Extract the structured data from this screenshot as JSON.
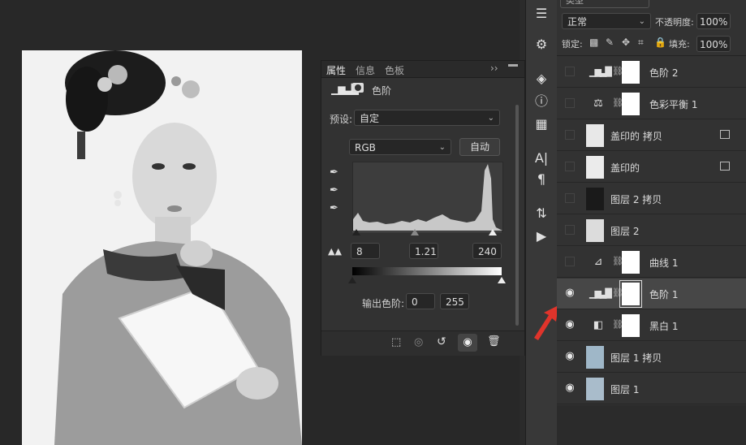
{
  "properties": {
    "tabs": [
      "属性",
      "信息",
      "色板"
    ],
    "panel_title": "色阶",
    "preset_label": "预设:",
    "preset_value": "自定",
    "channel_value": "RGB",
    "auto_label": "自动",
    "input_black": "8",
    "input_mid": "1.21",
    "input_white": "240",
    "output_label": "输出色阶:",
    "output_black": "0",
    "output_white": "255",
    "tab_overflow": "››"
  },
  "layers_panel": {
    "kind_label": "类型",
    "blend_mode": "正常",
    "opacity_label": "不透明度:",
    "opacity_value": "100%",
    "lock_label": "锁定:",
    "fill_label": "填充:",
    "fill_value": "100%",
    "layers": [
      {
        "name": "色阶 2",
        "visible": false,
        "type": "levels"
      },
      {
        "name": "色彩平衡 1",
        "visible": false,
        "type": "color-balance"
      },
      {
        "name": "盖印的 拷贝",
        "visible": false,
        "type": "pixel"
      },
      {
        "name": "盖印的",
        "visible": false,
        "type": "pixel"
      },
      {
        "name": "图层 2 拷贝",
        "visible": false,
        "type": "pixel"
      },
      {
        "name": "图层 2",
        "visible": false,
        "type": "pixel"
      },
      {
        "name": "曲线 1",
        "visible": false,
        "type": "curves"
      },
      {
        "name": "色阶 1",
        "visible": true,
        "type": "levels",
        "selected": true
      },
      {
        "name": "黑白 1",
        "visible": true,
        "type": "black-white"
      },
      {
        "name": "图层 1 拷贝",
        "visible": true,
        "type": "pixel"
      },
      {
        "name": "图层 1",
        "visible": true,
        "type": "pixel"
      }
    ]
  },
  "colors": {
    "accent_arrow": "#e0342b",
    "panel_bg": "#323232",
    "selected_row": "#474747"
  }
}
